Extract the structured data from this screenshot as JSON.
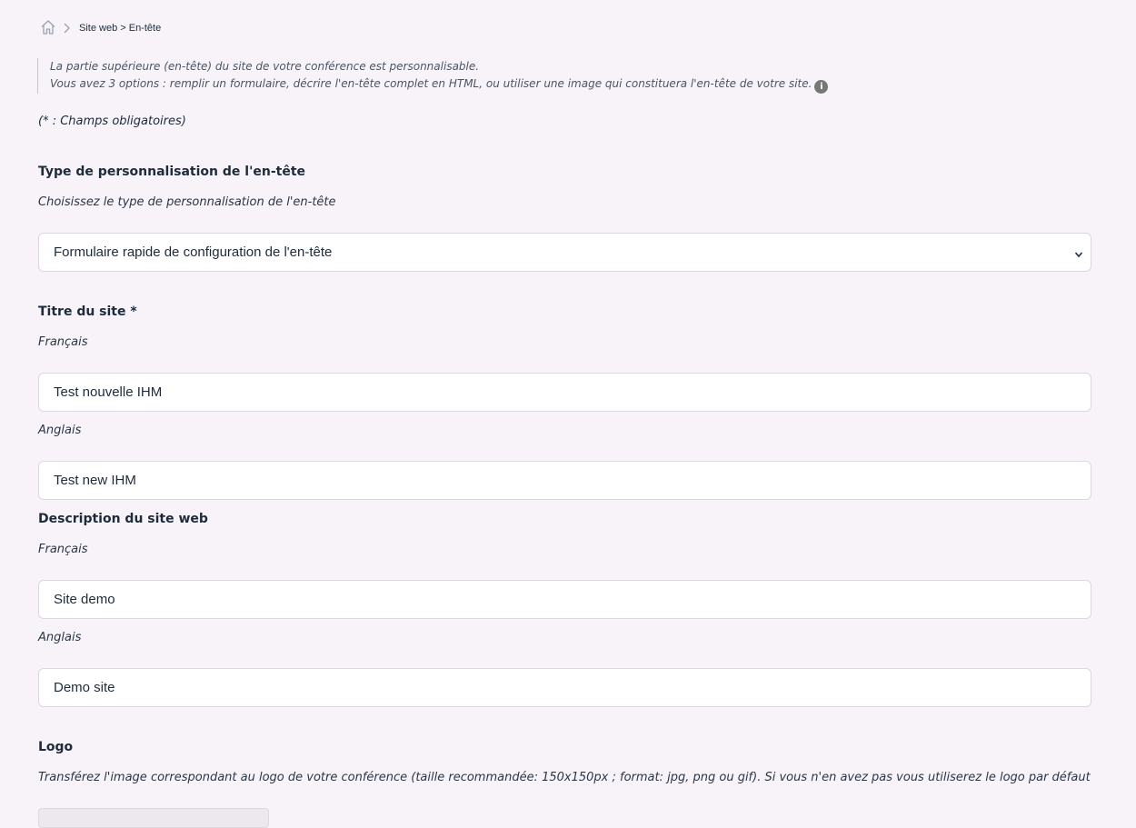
{
  "breadcrumb": {
    "text": "Site web > En-tête"
  },
  "info": {
    "line1": "La partie supérieure (en-tête) du site de votre conférence est personnalisable.",
    "line2": "Vous avez 3 options : remplir un formulaire, décrire l'en-tête complet en HTML, ou utiliser une image qui constituera l'en-tête de votre site."
  },
  "required_note": "(* : Champs obligatoires)",
  "header_type": {
    "title": "Type de personnalisation de l'en-tête",
    "hint": "Choisissez le type de personnalisation de l'en-tête",
    "selected": "Formulaire rapide de configuration de l'en-tête"
  },
  "site_title": {
    "title": "Titre du site *",
    "fr_label": "Français",
    "fr_value": "Test nouvelle IHM",
    "en_label": "Anglais",
    "en_value": "Test new IHM"
  },
  "site_description": {
    "title": "Description du site web",
    "fr_label": "Français",
    "fr_value": "Site demo",
    "en_label": "Anglais",
    "en_value": "Demo site"
  },
  "logo": {
    "title": "Logo",
    "hint": "Transférez l'image correspondant au logo de votre conférence (taille recommandée: 150x150px ; format: jpg, png ou gif). Si vous n'en avez pas vous utiliserez le logo par défaut"
  },
  "icons": [
    "home-icon",
    "chevron-right-icon",
    "info-icon",
    "chevron-down-icon"
  ]
}
